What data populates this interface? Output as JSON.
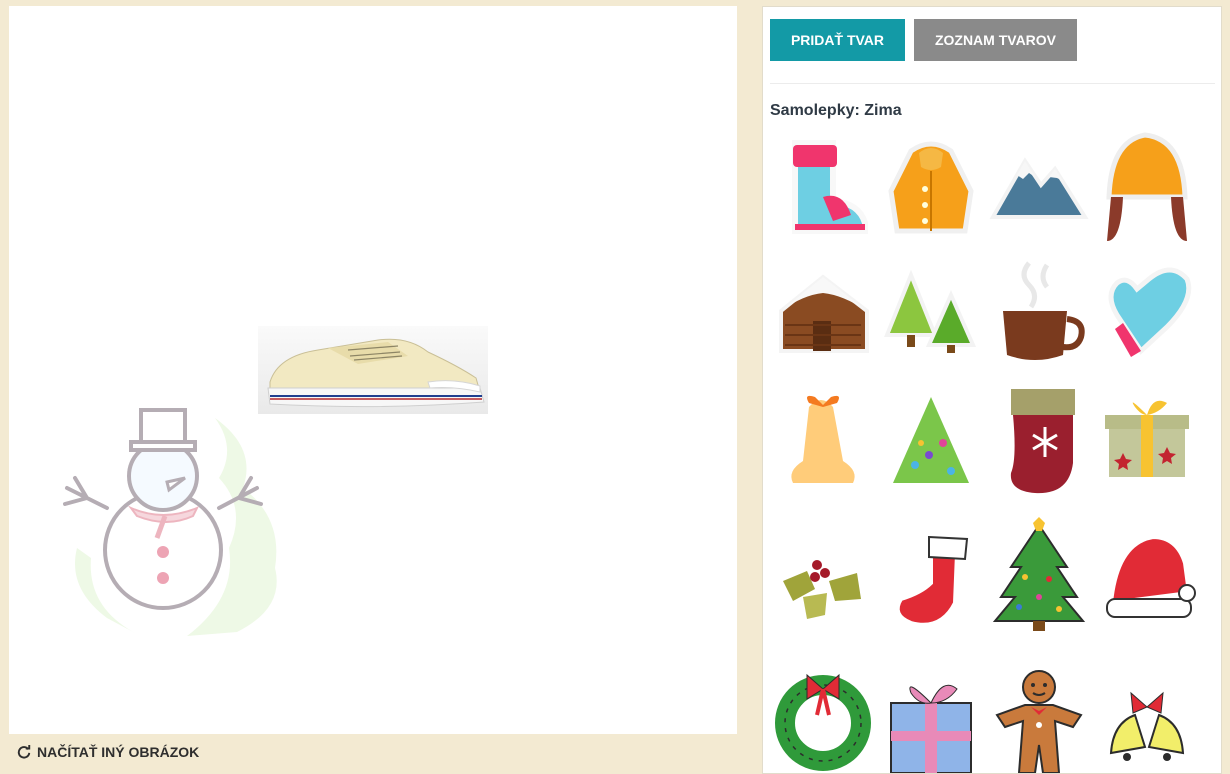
{
  "workspace": {
    "reload_label": "NAČÍTAŤ INÝ OBRÁZOK",
    "reload_icon": "refresh-icon",
    "objects": [
      "shoe-image",
      "snowman-sticker"
    ]
  },
  "panel": {
    "add_shape_label": "PRIDAŤ TVAR",
    "shape_list_label": "ZOZNAM TVAROV",
    "section_title": "Samolepky: Zima",
    "stickers": [
      "boot-icon",
      "jacket-icon",
      "mountain-icon",
      "winter-hat-icon",
      "cabin-icon",
      "pine-trees-icon",
      "hot-cocoa-icon",
      "mitten-icon",
      "bell-icon",
      "small-tree-icon",
      "stocking-icon",
      "gift-icon",
      "holly-icon",
      "red-stocking-icon",
      "christmas-tree-icon",
      "santa-hat-icon",
      "wreath-icon",
      "present-icon",
      "gingerbread-man-icon",
      "jingle-bells-icon"
    ]
  },
  "colors": {
    "page_bg": "#f3ead2",
    "add_button": "#139aa6",
    "list_button": "#8a8a8a"
  }
}
